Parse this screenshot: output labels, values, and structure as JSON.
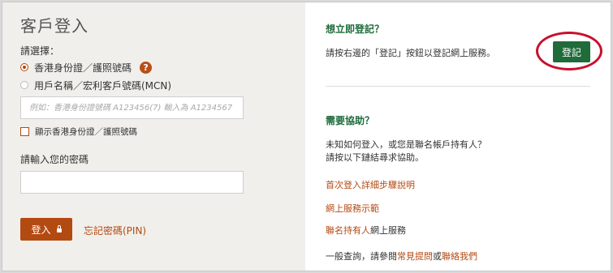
{
  "left": {
    "title": "客戶登入",
    "choose_label": "請選擇：",
    "options": [
      {
        "label": "香港身份證／護照號碼",
        "selected": true
      },
      {
        "label": "用戶名稱／宏利客戶號碼(MCN)",
        "selected": false
      }
    ],
    "help_icon": "?",
    "id_placeholder": "例如：香港身份證號碼 A123456(7) 輸入為 A1234567",
    "show_id_label": "顯示香港身份證／護照號碼",
    "password_label": "請輸入您的密碼",
    "login_label": "登入",
    "forgot_link": "忘記密碼(PIN)"
  },
  "right": {
    "register_heading": "想立即登記？",
    "register_text": "請按右邊的「登記」按鈕以登記網上服務。",
    "register_button": "登記",
    "help_heading": "需要協助？",
    "help_text_1": "未知如何登入，或您是聯名帳戶持有人？",
    "help_text_2": "請按以下鏈結尋求協助。",
    "links": [
      "首次登入詳細步驟說明",
      "網上服務示範"
    ],
    "joint_link": "聯名持有人",
    "joint_suffix": "網上服務",
    "faq_prefix": "一般查詢，請參閱",
    "faq_link": "常見提問",
    "faq_or": "或",
    "contact_link": "聯絡我們"
  },
  "colors": {
    "accent": "#b34a12",
    "green": "#1f6b3a",
    "highlight_oval": "#c8102e",
    "panel_bg": "#f1efeb"
  },
  "icons": [
    "help-icon",
    "lock-icon"
  ]
}
